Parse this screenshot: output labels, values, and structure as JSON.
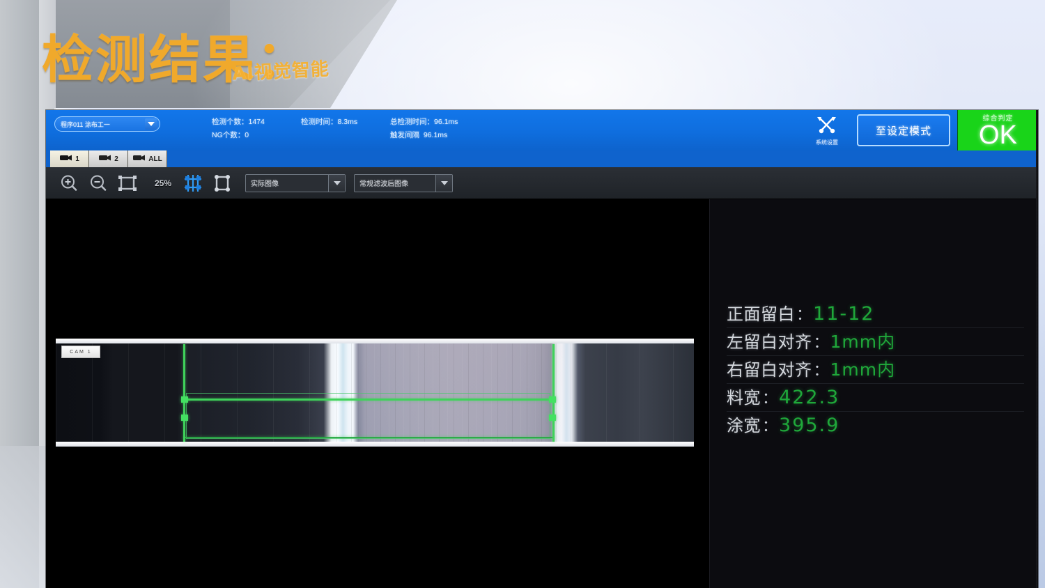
{
  "overlay": {
    "title": "检测结果：",
    "watermark": "AI视觉智能"
  },
  "header": {
    "preset_select": {
      "value": "程序011 涂布工一",
      "caret_icon": "chevron-down-icon"
    },
    "stats": {
      "count_label": "检测个数：",
      "count_value": "1474",
      "time_label": "检测时间：",
      "time_value": "8.3ms",
      "total_time_label": "总检测时间：",
      "total_time_value": "96.1ms",
      "ng_label": "NG个数：",
      "ng_value": "0",
      "trigger_label": "触发间隔",
      "trigger_value": "96.1ms"
    },
    "tool_button": {
      "label": "系统设置",
      "icon": "tools-icon"
    },
    "mode_button": {
      "label": "至设定模式"
    },
    "verdict": {
      "label": "综合判定",
      "value": "OK",
      "color": "#19d419"
    }
  },
  "camera_tabs": [
    {
      "label": "1",
      "icon": "camera-icon",
      "active": true
    },
    {
      "label": "2",
      "icon": "camera-icon",
      "active": false
    },
    {
      "label": "ALL",
      "icon": "camera-icon",
      "active": false
    }
  ],
  "toolbar": {
    "zoom_in_icon": "zoom-in-icon",
    "zoom_out_icon": "zoom-out-icon",
    "fit_icon": "fit-to-window-icon",
    "zoom_level": "25%",
    "grid_icon": "measure-grid-icon",
    "frame_icon": "select-frame-icon",
    "combo_display": {
      "value": "实际图像"
    },
    "combo_filter": {
      "value": "常规滤波后图像"
    }
  },
  "viewport": {
    "tag_label": "CAM 1",
    "accent_green": "#3fd25a"
  },
  "results": {
    "rows": [
      {
        "label": "正面留白",
        "value": "11-12"
      },
      {
        "label": "左留白对齐",
        "value": "1mm内"
      },
      {
        "label": "右留白对齐",
        "value": "1mm内"
      },
      {
        "label": "料宽",
        "value": "422.3"
      },
      {
        "label": "涂宽",
        "value": "395.9"
      }
    ]
  }
}
